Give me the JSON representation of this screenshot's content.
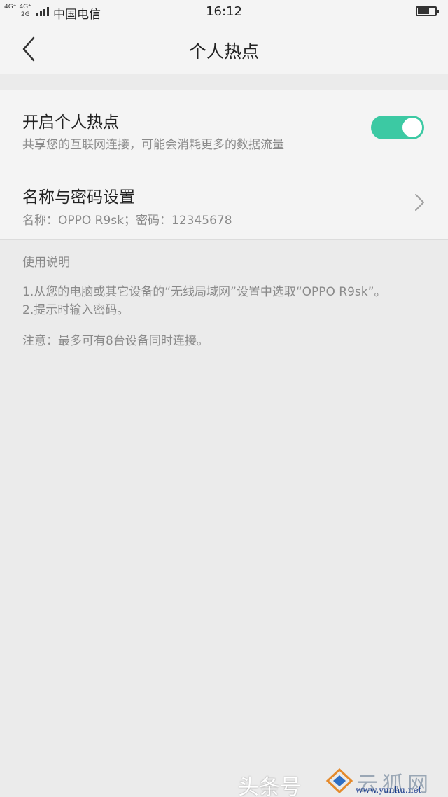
{
  "status_bar": {
    "net_type_1": "4G⁺",
    "net_type_2": "4G⁺",
    "net_type_3": "2G",
    "carrier": "中国电信",
    "time": "16:12",
    "battery_icon": "battery-icon"
  },
  "header": {
    "back_icon": "chevron-left-icon",
    "title": "个人热点"
  },
  "settings": {
    "hotspot": {
      "title": "开启个人热点",
      "subtitle": "共享您的互联网连接，可能会消耗更多的数据流量",
      "enabled": true,
      "toggle_color": "#3cc9a3"
    },
    "name_password": {
      "title": "名称与密码设置",
      "subtitle": "名称：OPPO R9sk；密码：12345678",
      "chevron_icon": "chevron-right-icon"
    }
  },
  "instructions": {
    "heading": "使用说明",
    "line1": "1.从您的电脑或其它设备的“无线局域网”设置中选取“OPPO R9sk”。",
    "line2": "2.提示时输入密码。",
    "note": "注意：最多可有8台设备同时连接。"
  },
  "watermark": {
    "text": "头条号",
    "site_name": "云狐网",
    "url": "www.yunhu.net"
  }
}
